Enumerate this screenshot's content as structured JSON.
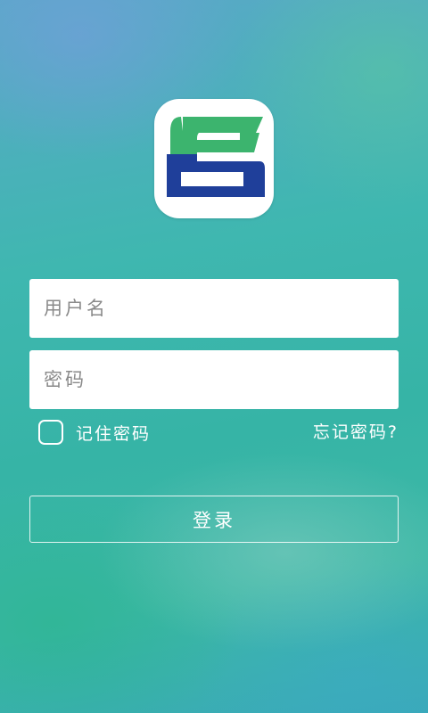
{
  "logo": {
    "icon": "app-logo-icon",
    "colors": {
      "green": "#3cb46e",
      "blue": "#1f3f9a"
    }
  },
  "form": {
    "username_placeholder": "用户名",
    "password_placeholder": "密码",
    "remember_label": "记住密码",
    "remember_checked": false,
    "forgot_label": "忘记密码?",
    "login_label": "登录"
  }
}
